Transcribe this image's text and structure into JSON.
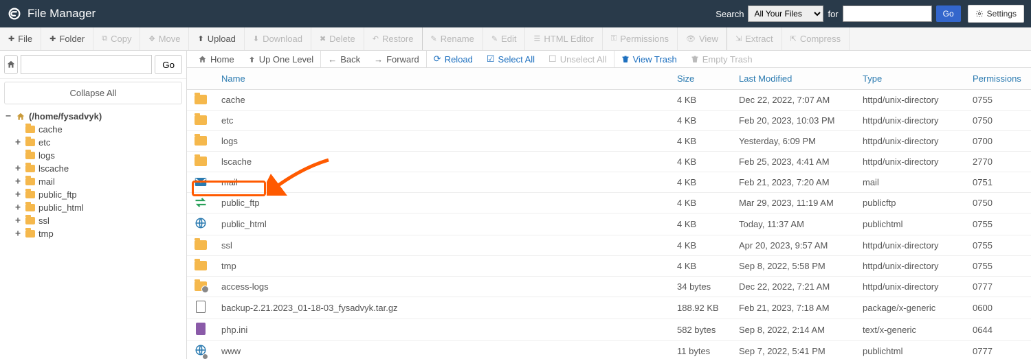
{
  "header": {
    "app_title": "File Manager",
    "search_label": "Search",
    "search_scope_selected": "All Your Files",
    "for_label": "for",
    "search_value": "",
    "go_label": "Go",
    "settings_label": "Settings"
  },
  "main_toolbar": [
    {
      "icon": "plus",
      "label": "File",
      "disabled": false
    },
    {
      "icon": "plus",
      "label": "Folder",
      "disabled": false
    },
    {
      "icon": "copy",
      "label": "Copy",
      "disabled": true
    },
    {
      "icon": "move",
      "label": "Move",
      "disabled": true
    },
    {
      "icon": "upload",
      "label": "Upload",
      "disabled": false
    },
    {
      "icon": "download",
      "label": "Download",
      "disabled": true
    },
    {
      "icon": "x",
      "label": "Delete",
      "disabled": true
    },
    {
      "icon": "undo",
      "label": "Restore",
      "disabled": true
    },
    {
      "icon": "rename",
      "label": "Rename",
      "disabled": true
    },
    {
      "icon": "edit",
      "label": "Edit",
      "disabled": true
    },
    {
      "icon": "html",
      "label": "HTML Editor",
      "disabled": true
    },
    {
      "icon": "key",
      "label": "Permissions",
      "disabled": true
    },
    {
      "icon": "eye",
      "label": "View",
      "disabled": true
    },
    {
      "icon": "extract",
      "label": "Extract",
      "disabled": true
    },
    {
      "icon": "compress",
      "label": "Compress",
      "disabled": true
    }
  ],
  "left": {
    "path_value": "",
    "go_label": "Go",
    "collapse_all": "Collapse All",
    "root_label": "(/home/fysadvyk)",
    "tree": [
      {
        "toggle": "",
        "icon": "folder",
        "label": "cache"
      },
      {
        "toggle": "+",
        "icon": "folder",
        "label": "etc"
      },
      {
        "toggle": "",
        "icon": "folder",
        "label": "logs"
      },
      {
        "toggle": "+",
        "icon": "folder",
        "label": "lscache"
      },
      {
        "toggle": "+",
        "icon": "folder",
        "label": "mail"
      },
      {
        "toggle": "+",
        "icon": "folder",
        "label": "public_ftp"
      },
      {
        "toggle": "+",
        "icon": "folder",
        "label": "public_html"
      },
      {
        "toggle": "+",
        "icon": "folder",
        "label": "ssl"
      },
      {
        "toggle": "+",
        "icon": "folder",
        "label": "tmp"
      }
    ]
  },
  "nav_toolbar": {
    "home": "Home",
    "up": "Up One Level",
    "back": "Back",
    "forward": "Forward",
    "reload": "Reload",
    "select_all": "Select All",
    "unselect_all": "Unselect All",
    "view_trash": "View Trash",
    "empty_trash": "Empty Trash"
  },
  "table": {
    "headers": {
      "name": "Name",
      "size": "Size",
      "modified": "Last Modified",
      "type": "Type",
      "perm": "Permissions"
    },
    "rows": [
      {
        "icon": "folder",
        "name": "cache",
        "size": "4 KB",
        "modified": "Dec 22, 2022, 7:07 AM",
        "type": "httpd/unix-directory",
        "perm": "0755"
      },
      {
        "icon": "folder",
        "name": "etc",
        "size": "4 KB",
        "modified": "Feb 20, 2023, 10:03 PM",
        "type": "httpd/unix-directory",
        "perm": "0750"
      },
      {
        "icon": "folder",
        "name": "logs",
        "size": "4 KB",
        "modified": "Yesterday, 6:09 PM",
        "type": "httpd/unix-directory",
        "perm": "0700"
      },
      {
        "icon": "folder",
        "name": "lscache",
        "size": "4 KB",
        "modified": "Feb 25, 2023, 4:41 AM",
        "type": "httpd/unix-directory",
        "perm": "2770"
      },
      {
        "icon": "mail",
        "name": "mail",
        "size": "4 KB",
        "modified": "Feb 21, 2023, 7:20 AM",
        "type": "mail",
        "perm": "0751"
      },
      {
        "icon": "ftp",
        "name": "public_ftp",
        "size": "4 KB",
        "modified": "Mar 29, 2023, 11:19 AM",
        "type": "publicftp",
        "perm": "0750"
      },
      {
        "icon": "globe",
        "name": "public_html",
        "size": "4 KB",
        "modified": "Today, 11:37 AM",
        "type": "publichtml",
        "perm": "0755",
        "highlight": true
      },
      {
        "icon": "folder",
        "name": "ssl",
        "size": "4 KB",
        "modified": "Apr 20, 2023, 9:57 AM",
        "type": "httpd/unix-directory",
        "perm": "0755"
      },
      {
        "icon": "folder",
        "name": "tmp",
        "size": "4 KB",
        "modified": "Sep 8, 2022, 5:58 PM",
        "type": "httpd/unix-directory",
        "perm": "0755"
      },
      {
        "icon": "folder-link",
        "name": "access-logs",
        "size": "34 bytes",
        "modified": "Dec 22, 2022, 7:21 AM",
        "type": "httpd/unix-directory",
        "perm": "0777"
      },
      {
        "icon": "archive",
        "name": "backup-2.21.2023_01-18-03_fysadvyk.tar.gz",
        "size": "188.92 KB",
        "modified": "Feb 21, 2023, 7:18 AM",
        "type": "package/x-generic",
        "perm": "0600"
      },
      {
        "icon": "text",
        "name": "php.ini",
        "size": "582 bytes",
        "modified": "Sep 8, 2022, 2:14 AM",
        "type": "text/x-generic",
        "perm": "0644"
      },
      {
        "icon": "globe-link",
        "name": "www",
        "size": "11 bytes",
        "modified": "Sep 7, 2022, 5:41 PM",
        "type": "publichtml",
        "perm": "0777"
      }
    ]
  }
}
